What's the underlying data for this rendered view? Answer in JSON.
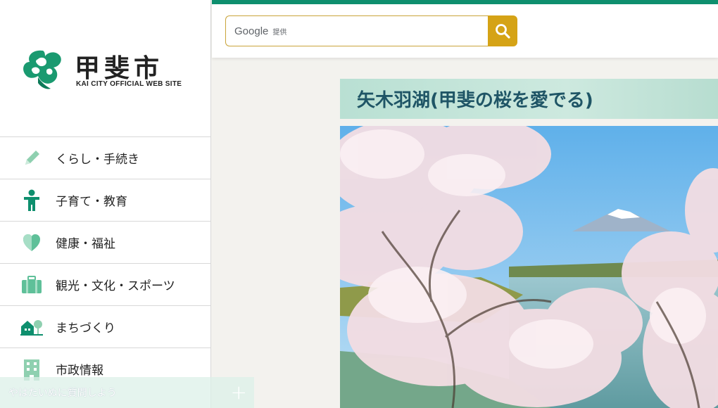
{
  "logo": {
    "title": "甲斐市",
    "subtitle": "KAI CITY OFFICIAL WEB SITE"
  },
  "nav": {
    "items": [
      {
        "label": "くらし・手続き",
        "icon": "pencil-icon"
      },
      {
        "label": "子育て・教育",
        "icon": "child-icon"
      },
      {
        "label": "健康・福祉",
        "icon": "heart-icon"
      },
      {
        "label": "観光・文化・スポーツ",
        "icon": "suitcase-icon"
      },
      {
        "label": "まちづくり",
        "icon": "house-tree-icon"
      },
      {
        "label": "市政情報",
        "icon": "building-icon"
      }
    ]
  },
  "chat": {
    "text": "やはたいぬに質問しよう",
    "plus": "+"
  },
  "search": {
    "google": "Google",
    "provided": "提供"
  },
  "feature": {
    "title": "矢木羽湖(甲斐の桜を愛でる)"
  },
  "colors": {
    "brand_green": "#0e8f6e",
    "search_button": "#d5a316",
    "banner_bg": "#c4e5da",
    "banner_text": "#1f5566"
  }
}
